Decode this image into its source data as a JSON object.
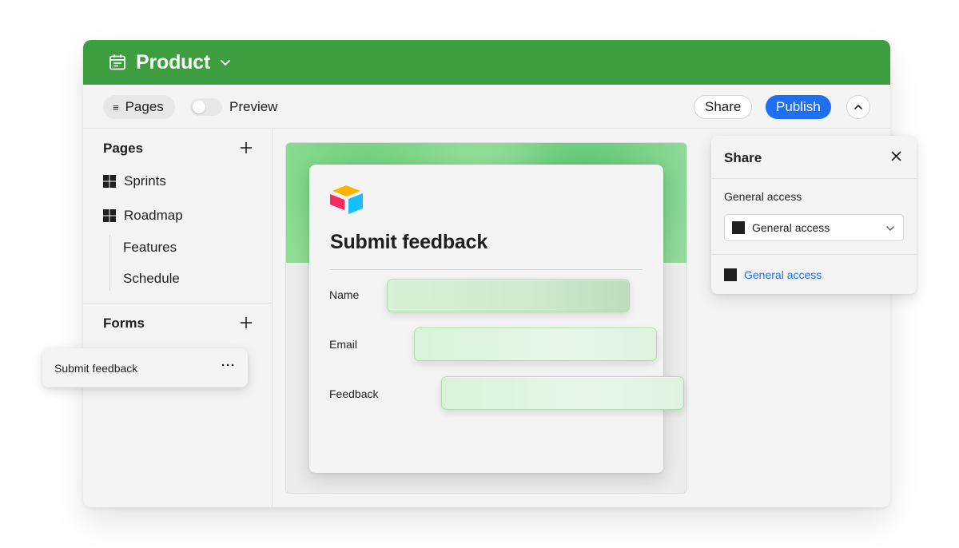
{
  "app": {
    "title": "Product",
    "brand_color": "#3e9e3f",
    "accent_color": "#1e6ff1"
  },
  "toolbar": {
    "pages_label": "Pages",
    "preview_label": "Preview",
    "preview_enabled": false,
    "share_label": "Share",
    "publish_label": "Publish"
  },
  "sidebar": {
    "pages_header": "Pages",
    "pages": [
      {
        "label": "Sprints",
        "icon": "grid-icon"
      },
      {
        "label": "Roadmap",
        "icon": "grid-icon"
      }
    ],
    "subpages": [
      "Features",
      "Schedule"
    ],
    "forms_header": "Forms",
    "forms": [
      {
        "label": "Submit feedback",
        "more": "···"
      }
    ]
  },
  "form": {
    "title": "Submit feedback",
    "fields": [
      {
        "label": "Name"
      },
      {
        "label": "Email"
      },
      {
        "label": "Feedback"
      }
    ]
  },
  "share_panel": {
    "title": "Share",
    "access_label": "General access",
    "access_selected": "General access",
    "access_link": "General access"
  }
}
